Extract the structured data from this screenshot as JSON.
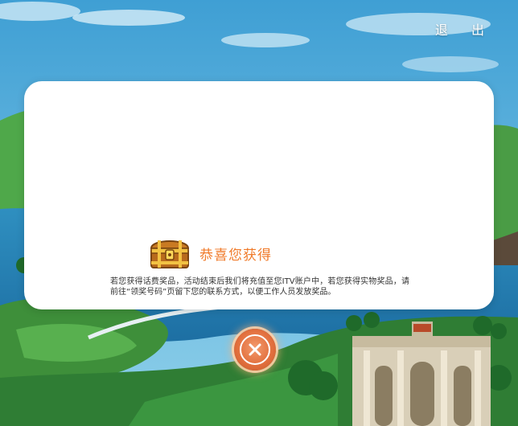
{
  "header": {
    "exit_label": "退 出"
  },
  "modal": {
    "title": "恭喜您获得",
    "description": "若您获得话费奖品，活动结束后我们将充值至您ITV账户中，若您获得实物奖品，请前往“领奖号码”页留下您的联系方式，以便工作人员发放奖品。"
  },
  "icons": {
    "prize": "treasure-chest-icon",
    "close": "close-icon"
  },
  "colors": {
    "title_accent": "#f07b2b",
    "close_button": "#e2703e",
    "modal_bg": "#ffffff"
  }
}
